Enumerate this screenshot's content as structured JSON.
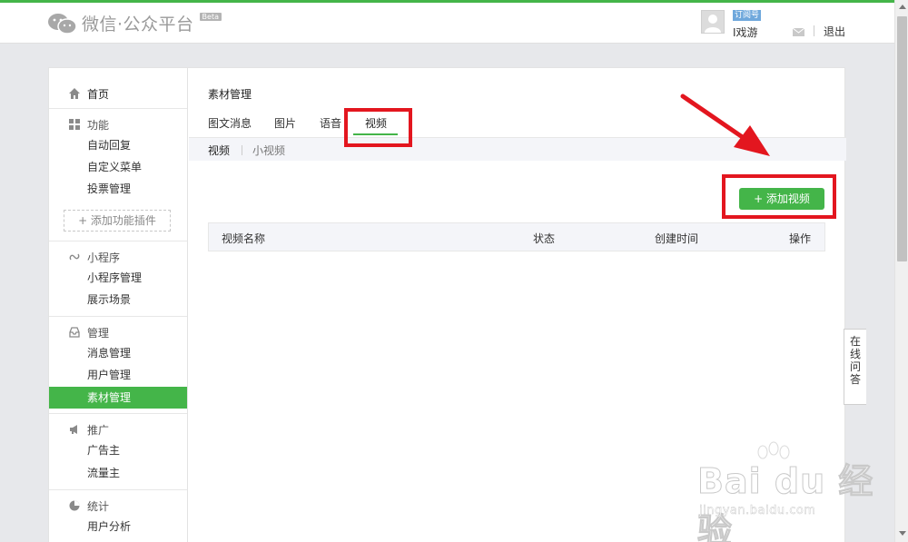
{
  "header": {
    "logo_text": "微信·公众平台",
    "beta_badge": "Beta",
    "account_type": "订阅号",
    "username": "I戏游",
    "logout_label": "退出"
  },
  "sidebar": {
    "home": "首页",
    "sections": [
      {
        "title": "功能",
        "icon": "grid-icon",
        "items": [
          "自动回复",
          "自定义菜单",
          "投票管理"
        ]
      },
      {
        "title": "小程序",
        "icon": "miniprogram-icon",
        "items": [
          "小程序管理",
          "展示场景"
        ]
      },
      {
        "title": "管理",
        "icon": "inbox-icon",
        "items": [
          "消息管理",
          "用户管理",
          "素材管理"
        ]
      },
      {
        "title": "推广",
        "icon": "megaphone-icon",
        "items": [
          "广告主",
          "流量主"
        ]
      },
      {
        "title": "统计",
        "icon": "pie-icon",
        "items": [
          "用户分析"
        ]
      }
    ],
    "add_plugin_label": "+ 添加功能插件",
    "active_item": "素材管理"
  },
  "main": {
    "page_title": "素材管理",
    "tabs": [
      "图文消息",
      "图片",
      "语音",
      "视频"
    ],
    "active_tab": "视频",
    "subtabs": [
      "视频",
      "小视频"
    ],
    "add_button_label": "+ 添加视频",
    "table_columns": [
      "视频名称",
      "状态",
      "创建时间",
      "操作"
    ]
  },
  "floating": {
    "online_qa": [
      "在",
      "线",
      "问",
      "答"
    ]
  },
  "watermark": {
    "brand": "Bai du 经验",
    "url": "jingyan.baidu.com"
  },
  "colors": {
    "brand_green": "#44b549",
    "annotation_red": "#e3161f"
  }
}
